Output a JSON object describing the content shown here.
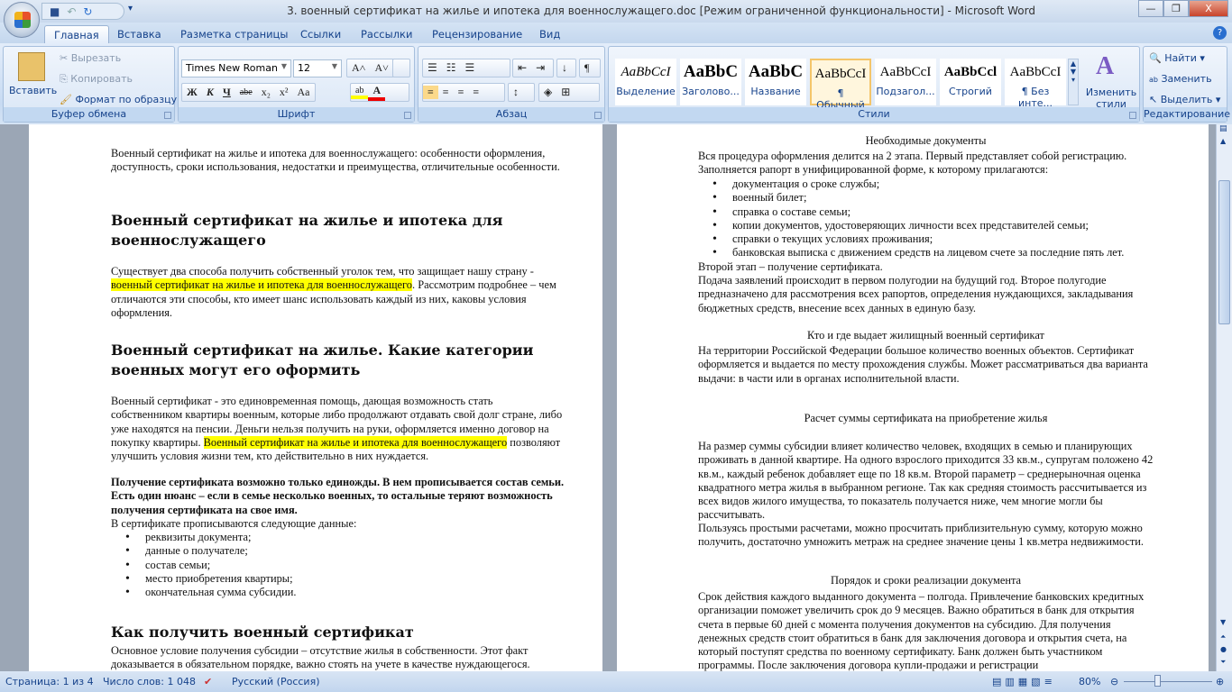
{
  "window": {
    "title": "3. военный сертификат на жилье и ипотека для военнослужащего.doc [Режим ограниченной функциональности] - Microsoft Word",
    "minimize": "—",
    "restore": "❐",
    "close": "X"
  },
  "tabs": [
    "Главная",
    "Вставка",
    "Разметка страницы",
    "Ссылки",
    "Рассылки",
    "Рецензирование",
    "Вид"
  ],
  "clipboard": {
    "paste": "Вставить",
    "cut": "Вырезать",
    "copy": "Копировать",
    "format_painter": "Формат по образцу",
    "label": "Буфер обмена"
  },
  "font": {
    "name": "Times New Roman",
    "size": "12",
    "label": "Шрифт",
    "bold": "Ж",
    "italic": "К",
    "underline": "Ч",
    "strike": "abe",
    "sub": "x₂",
    "sup": "x²",
    "case": "Aa",
    "grow": "A˄",
    "shrink": "A˅"
  },
  "paragraph": {
    "label": "Абзац"
  },
  "styles": {
    "label": "Стили",
    "items": [
      {
        "preview": "AaBbCcI",
        "name": "Выделение"
      },
      {
        "preview": "AaBbC",
        "name": "Заголово..."
      },
      {
        "preview": "AaBbC",
        "name": "Название"
      },
      {
        "preview": "AaBbCcI",
        "name": "¶ Обычный"
      },
      {
        "preview": "AaBbCcI",
        "name": "Подзагол..."
      },
      {
        "preview": "AaBbCcl",
        "name": "Строгий"
      },
      {
        "preview": "AaBbCcI",
        "name": "¶ Без инте..."
      }
    ],
    "change": "Изменить стили"
  },
  "editing": {
    "label": "Редактирование",
    "find": "Найти",
    "replace": "Заменить",
    "select": "Выделить"
  },
  "left_page": {
    "intro": "Военный сертификат на жилье и ипотека для военнослужащего: особенности оформления, доступность, сроки использования, недостатки и преимущества, отличительные особенности.",
    "h1": "Военный сертификат на жилье и ипотека для военнослужащего",
    "p2a": "Существует два способа получить собственный уголок тем, что защищает нашу страну - ",
    "p2hl": "военный сертификат на жилье и ипотека для военнослужащего",
    "p2b": ". Рассмотрим подробнее – чем отличаются эти способы, кто имеет шанс использовать каждый из них, каковы условия оформления.",
    "h2": "Военный сертификат на жилье. Какие категории военных могут его оформить",
    "p3a": "Военный сертификат - это единовременная помощь, дающая возможность стать собственником квартиры военным, которые либо продолжают отдавать свой долг стране, либо уже находятся на пенсии. Деньги нельзя получить на руки, оформляется именно договор на покупку квартиры. ",
    "p3hl": "Военный сертификат на жилье и ипотека для военнослужащего",
    "p3b": " позволяют улучшить условия жизни тем, кто действительно в них нуждается.",
    "bold": "Получение сертификата возможно только единожды. В нем прописывается состав семьи. Есть один нюанс – если в семье несколько военных, то остальные теряют возможность получения сертификата на свое имя.",
    "list_intro": "В сертификате прописываются следующие данные:",
    "list": [
      "реквизиты документа;",
      "данные о получателе;",
      "состав семьи;",
      "место приобретения квартиры;",
      "окончательная сумма субсидии."
    ],
    "h3": "Как получить военный сертификат",
    "p4": "Основное условие получения субсидии – отсутствие жилья в собственности. Этот факт доказывается в обязательном порядке, важно стоять на учете в качестве нуждающегося."
  },
  "right_page": {
    "t1": "Необходимые документы",
    "p1": "Вся процедура оформления делится на 2 этапа. Первый представляет собой регистрацию. Заполняется рапорт в унифицированной форме, к которому прилагаются:",
    "list": [
      "документация о сроке службы;",
      "военный билет;",
      "справка о составе семьи;",
      "копии документов, удостоверяющих личности всех представителей семьи;",
      "справки о текущих условиях проживания;",
      "банковская выписка с движением средств на лицевом счете за последние пять лет."
    ],
    "p2": "Второй этап – получение сертификата.",
    "p3": "Подача заявлений происходит в первом полугодии на будущий год. Второе полугодие предназначено для рассмотрения всех рапортов, определения нуждающихся, закладывания бюджетных средств, внесение всех данных в единую базу.",
    "t2": "Кто и где выдает жилищный военный сертификат",
    "p4": "На территории Российской Федерации большое количество военных объектов. Сертификат оформляется и выдается по месту прохождения службы. Может рассматриваться два варианта выдачи: в части или в органах исполнительной власти.",
    "t3": "Расчет суммы сертификата на приобретение жилья",
    "p5": "На размер суммы субсидии влияет количество человек, входящих в семью и планирующих проживать в данной квартире. На одного взрослого приходится 33 кв.м., супругам положено 42 кв.м., каждый ребенок добавляет еще по 18 кв.м. Второй параметр – среднерыночная оценка квадратного метра жилья в выбранном регионе. Так как средняя стоимость рассчитывается из всех видов жилого имущества, то показатель получается ниже, чем многие могли бы рассчитывать.",
    "p6": "Пользуясь простыми расчетами, можно просчитать приблизительную сумму, которую можно получить, достаточно умножить метраж на среднее значение цены 1 кв.метра недвижимости.",
    "t4": "Порядок и сроки реализации документа",
    "p7": "Срок действия каждого выданного документа – полгода. Привлечение банковских кредитных организации поможет увеличить срок до 9 месяцев. Важно обратиться в банк для открытия счета в первые 60 дней с момента получения документов на субсидию. Для получения денежных средств стоит обратиться в банк для заключения договора и открытия счета, на который поступят средства по военному сертификату. Банк должен быть участником программы. После заключения договора купли-продажи и регистрации"
  },
  "status": {
    "page": "Страница: 1 из 4",
    "words": "Число слов: 1 048",
    "language": "Русский (Россия)",
    "zoom": "80%"
  }
}
